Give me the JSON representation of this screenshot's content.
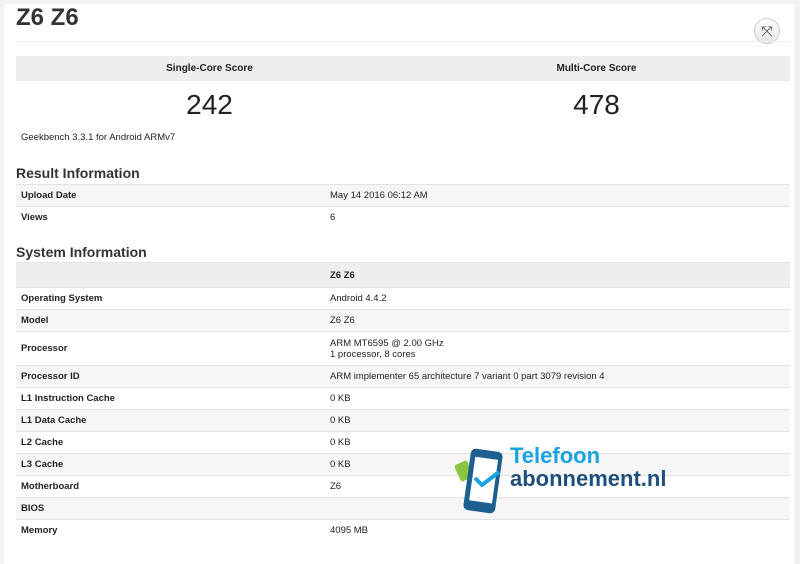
{
  "title": "Z6 Z6",
  "scores": {
    "single_label": "Single-Core Score",
    "single_value": "242",
    "multi_label": "Multi-Core Score",
    "multi_value": "478"
  },
  "version": "Geekbench 3.3.1 for Android ARMv7",
  "result_info": {
    "heading": "Result Information",
    "rows": [
      {
        "k": "Upload Date",
        "v": "May 14 2016 06:12 AM"
      },
      {
        "k": "Views",
        "v": "6"
      }
    ]
  },
  "system_info": {
    "heading": "System Information",
    "column": "Z6 Z6",
    "rows": [
      {
        "k": "Operating System",
        "v": "Android 4.4.2"
      },
      {
        "k": "Model",
        "v": "Z6 Z6"
      },
      {
        "k": "Processor",
        "v": "ARM MT6595 @ 2.00 GHz",
        "v2": "1 processor, 8 cores"
      },
      {
        "k": "Processor ID",
        "v": "ARM implementer 65 architecture 7 variant 0 part 3079 revision 4"
      },
      {
        "k": "L1 Instruction Cache",
        "v": "0 KB"
      },
      {
        "k": "L1 Data Cache",
        "v": "0 KB"
      },
      {
        "k": "L2 Cache",
        "v": "0 KB"
      },
      {
        "k": "L3 Cache",
        "v": "0 KB"
      },
      {
        "k": "Motherboard",
        "v": "Z6"
      },
      {
        "k": "BIOS",
        "v": ""
      },
      {
        "k": "Memory",
        "v": "4095 MB"
      }
    ]
  },
  "watermark": {
    "line1": "Telefoon",
    "line2": "abonnement.nl"
  }
}
